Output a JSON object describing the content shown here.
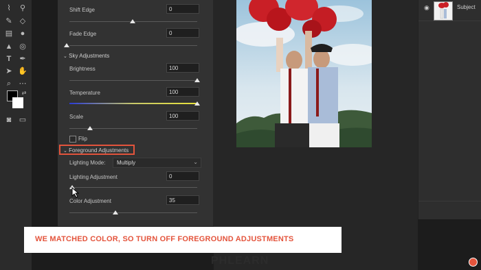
{
  "properties": {
    "shift_edge": {
      "label": "Shift Edge",
      "value": "0"
    },
    "fade_edge": {
      "label": "Fade Edge",
      "value": "0"
    },
    "sky_section": "Sky Adjustments",
    "brightness": {
      "label": "Brightness",
      "value": "100"
    },
    "temperature": {
      "label": "Temperature",
      "value": "100"
    },
    "scale": {
      "label": "Scale",
      "value": "100"
    },
    "flip": {
      "label": "Flip",
      "checked": false
    },
    "foreground_section": "Foreground Adjustments",
    "lighting_mode": {
      "label": "Lighting Mode:",
      "value": "Multiply"
    },
    "lighting_adjustment": {
      "label": "Lighting Adjustment",
      "value": "0"
    },
    "color_adjustment": {
      "label": "Color Adjustment",
      "value": "35"
    }
  },
  "layers": {
    "subject_label": "Subject"
  },
  "banner": {
    "text": "WE MATCHED COLOR, SO TURN OFF FOREGROUND ADJUSTMENTS"
  },
  "watermark": "PHLEARN",
  "colors": {
    "accent": "#e4543c",
    "highlight_border": "#e4543c",
    "panel_bg": "#323232",
    "temperature_start": "#2a3bd6",
    "temperature_end": "#e8e23a"
  },
  "icons": [
    "stamp-icon",
    "brush-icon",
    "eraser-icon",
    "gradient-icon",
    "blur-icon",
    "dodge-icon",
    "pen-icon",
    "type-icon",
    "path-select-icon",
    "hand-icon",
    "zoom-icon",
    "more-icon",
    "eye-icon"
  ]
}
